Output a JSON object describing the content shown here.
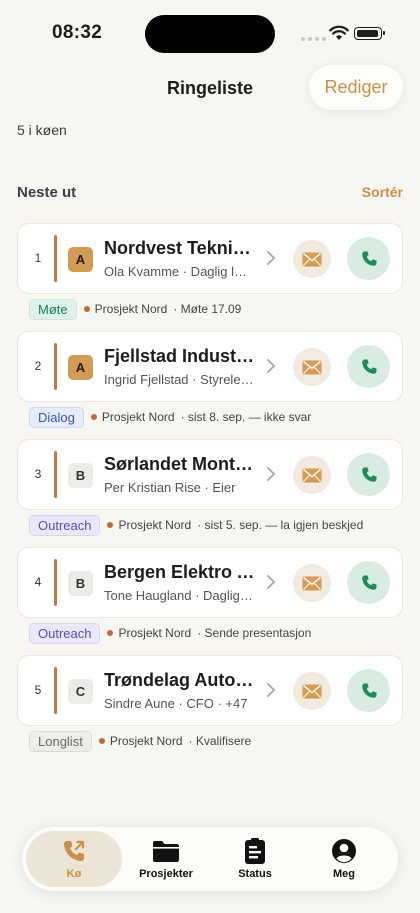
{
  "status_bar": {
    "time": "08:32"
  },
  "nav": {
    "title": "Ringeliste",
    "edit_label": "Rediger"
  },
  "queue": {
    "count_text": "5 i køen"
  },
  "section": {
    "title": "Neste ut",
    "sort_label": "Sortér"
  },
  "items": [
    {
      "rank": "1",
      "tier": "A",
      "company": "Nordvest Teknikk AS",
      "contact": "Ola Kvamme · Daglig leder",
      "tag": "Møte",
      "tag_style": "mote",
      "project": "Prosjekt Nord",
      "note": "· Møte 17.09"
    },
    {
      "rank": "2",
      "tier": "A",
      "company": "Fjellstad Industri AS",
      "contact": "Ingrid Fjellstad · Styreleder",
      "tag": "Dialog",
      "tag_style": "dialog",
      "project": "Prosjekt Nord",
      "note": "· sist 8. sep. — ikke svar"
    },
    {
      "rank": "3",
      "tier": "B",
      "company": "Sørlandet Montasje AS",
      "contact": "Per Kristian Rise · Eier",
      "tag": "Outreach",
      "tag_style": "outreach",
      "project": "Prosjekt Nord",
      "note": "· sist 5. sep. — la igjen beskjed"
    },
    {
      "rank": "4",
      "tier": "B",
      "company": "Bergen Elektro AS",
      "contact": "Tone Haugland · Daglig leder",
      "tag": "Outreach",
      "tag_style": "outreach",
      "project": "Prosjekt Nord",
      "note": "· Sende presentasjon"
    },
    {
      "rank": "5",
      "tier": "C",
      "company": "Trøndelag Automasjon AS",
      "contact": "Sindre Aune · CFO · +47",
      "tag": "Longlist",
      "tag_style": "longlist",
      "project": "Prosjekt Nord",
      "note": "· Kvalifisere"
    }
  ],
  "tabs": [
    {
      "label": "Kø",
      "icon": "phone-outgoing-icon"
    },
    {
      "label": "Prosjekter",
      "icon": "folder-icon"
    },
    {
      "label": "Status",
      "icon": "clipboard-icon"
    },
    {
      "label": "Meg",
      "icon": "person-icon"
    }
  ],
  "colors": {
    "accent": "#c8904a",
    "call": "#1f8a55",
    "background": "#f8f6f1"
  }
}
